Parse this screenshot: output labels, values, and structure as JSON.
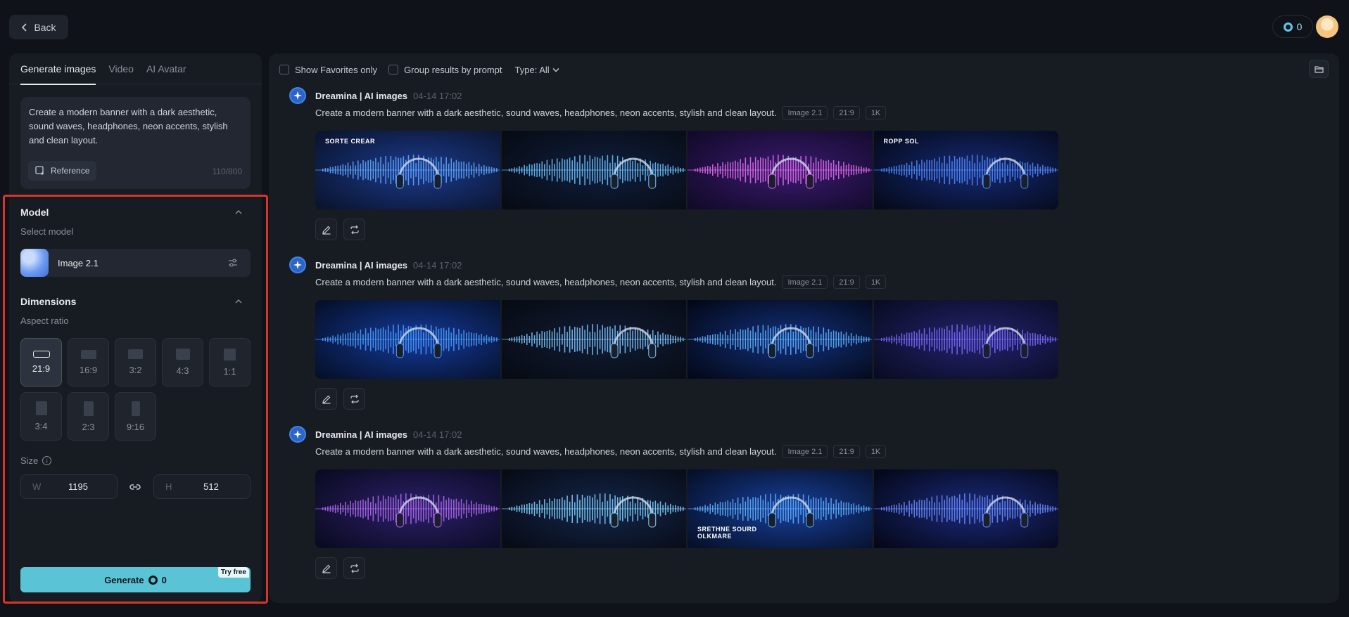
{
  "top": {
    "back_label": "Back",
    "credits": "0"
  },
  "left": {
    "tabs": [
      "Generate images",
      "Video",
      "AI Avatar"
    ],
    "prompt": "Create a modern banner with a dark aesthetic, sound waves, headphones, neon accents, stylish and clean layout.",
    "reference_label": "Reference",
    "char_count": "110/800",
    "model_section": "Model",
    "select_model_label": "Select model",
    "model_name": "Image 2.1",
    "dimensions_section": "Dimensions",
    "aspect_ratio_label": "Aspect ratio",
    "ratios": [
      "21:9",
      "16:9",
      "3:2",
      "4:3",
      "1:1",
      "3:4",
      "2:3",
      "9:16"
    ],
    "selected_ratio": "21:9",
    "size_label": "Size",
    "width_prefix": "W",
    "width_value": "1195",
    "height_prefix": "H",
    "height_value": "512",
    "generate_label": "Generate",
    "generate_cost": "0",
    "try_free": "Try free"
  },
  "main": {
    "show_favorites": "Show Favorites only",
    "group_by_prompt": "Group results by prompt",
    "type_filter": "Type: All",
    "groups": [
      {
        "title": "Dreamina | AI images",
        "time": "04-14 17:02",
        "prompt": "Create a modern banner with a dark aesthetic, sound waves, headphones, neon accents, stylish and clean layout.",
        "tags": [
          "Image 2.1",
          "21:9",
          "1K"
        ],
        "thumb_texts": [
          "SORTE CREAR",
          "",
          "",
          "ROPP SOL"
        ]
      },
      {
        "title": "Dreamina | AI images",
        "time": "04-14 17:02",
        "prompt": "Create a modern banner with a dark aesthetic, sound waves, headphones, neon accents, stylish and clean layout.",
        "tags": [
          "Image 2.1",
          "21:9",
          "1K"
        ],
        "thumb_texts": [
          "",
          "",
          "",
          ""
        ]
      },
      {
        "title": "Dreamina | AI images",
        "time": "04-14 17:02",
        "prompt": "Create a modern banner with a dark aesthetic, sound waves, headphones, neon accents, stylish and clean layout.",
        "tags": [
          "Image 2.1",
          "21:9",
          "1K"
        ],
        "thumb_texts": [
          "",
          "",
          "SRETHNE SOURD OLKMARE",
          ""
        ]
      }
    ]
  },
  "colors": {
    "accent": "#5ac3d6",
    "highlight_border": "#d8352a",
    "background": "#0f1218",
    "panel": "#171b22"
  }
}
